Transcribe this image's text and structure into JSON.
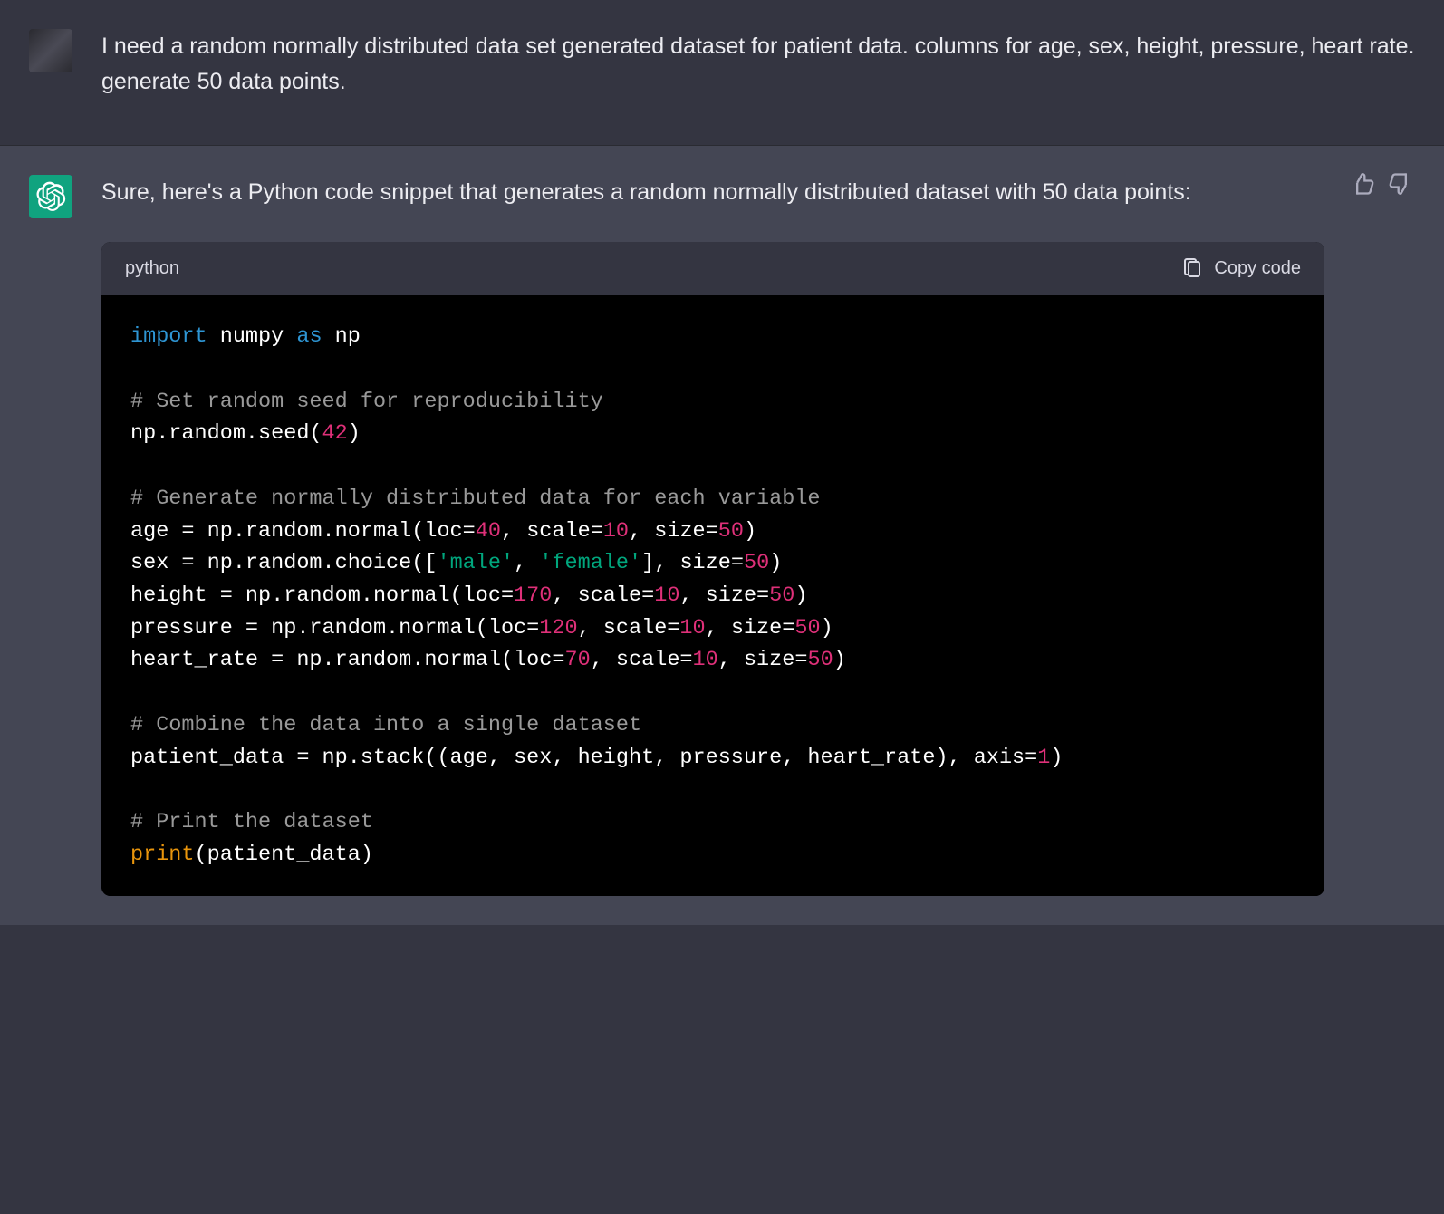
{
  "user": {
    "message": "I need a random normally distributed data set generated dataset for patient data. columns for age, sex, height, pressure, heart rate. generate 50 data points."
  },
  "assistant": {
    "intro": "Sure, here's a Python code snippet that generates a random normally distributed dataset with 50 data points:",
    "code_lang": "python",
    "copy_label": "Copy code",
    "code_tokens": [
      [
        {
          "t": "import ",
          "c": "kw"
        },
        {
          "t": "numpy ",
          "c": "plain"
        },
        {
          "t": "as ",
          "c": "kw"
        },
        {
          "t": "np",
          "c": "plain"
        }
      ],
      [],
      [
        {
          "t": "# Set random seed for reproducibility",
          "c": "com"
        }
      ],
      [
        {
          "t": "np.random.seed(",
          "c": "plain"
        },
        {
          "t": "42",
          "c": "num"
        },
        {
          "t": ")",
          "c": "plain"
        }
      ],
      [],
      [
        {
          "t": "# Generate normally distributed data for each variable",
          "c": "com"
        }
      ],
      [
        {
          "t": "age = np.random.normal(loc=",
          "c": "plain"
        },
        {
          "t": "40",
          "c": "num"
        },
        {
          "t": ", scale=",
          "c": "plain"
        },
        {
          "t": "10",
          "c": "num"
        },
        {
          "t": ", size=",
          "c": "plain"
        },
        {
          "t": "50",
          "c": "num"
        },
        {
          "t": ")",
          "c": "plain"
        }
      ],
      [
        {
          "t": "sex = np.random.choice([",
          "c": "plain"
        },
        {
          "t": "'male'",
          "c": "str"
        },
        {
          "t": ", ",
          "c": "plain"
        },
        {
          "t": "'female'",
          "c": "str"
        },
        {
          "t": "], size=",
          "c": "plain"
        },
        {
          "t": "50",
          "c": "num"
        },
        {
          "t": ")",
          "c": "plain"
        }
      ],
      [
        {
          "t": "height = np.random.normal(loc=",
          "c": "plain"
        },
        {
          "t": "170",
          "c": "num"
        },
        {
          "t": ", scale=",
          "c": "plain"
        },
        {
          "t": "10",
          "c": "num"
        },
        {
          "t": ", size=",
          "c": "plain"
        },
        {
          "t": "50",
          "c": "num"
        },
        {
          "t": ")",
          "c": "plain"
        }
      ],
      [
        {
          "t": "pressure = np.random.normal(loc=",
          "c": "plain"
        },
        {
          "t": "120",
          "c": "num"
        },
        {
          "t": ", scale=",
          "c": "plain"
        },
        {
          "t": "10",
          "c": "num"
        },
        {
          "t": ", size=",
          "c": "plain"
        },
        {
          "t": "50",
          "c": "num"
        },
        {
          "t": ")",
          "c": "plain"
        }
      ],
      [
        {
          "t": "heart_rate = np.random.normal(loc=",
          "c": "plain"
        },
        {
          "t": "70",
          "c": "num"
        },
        {
          "t": ", scale=",
          "c": "plain"
        },
        {
          "t": "10",
          "c": "num"
        },
        {
          "t": ", size=",
          "c": "plain"
        },
        {
          "t": "50",
          "c": "num"
        },
        {
          "t": ")",
          "c": "plain"
        }
      ],
      [],
      [
        {
          "t": "# Combine the data into a single dataset",
          "c": "com"
        }
      ],
      [
        {
          "t": "patient_data = np.stack((age, sex, height, pressure, heart_rate), axis=",
          "c": "plain"
        },
        {
          "t": "1",
          "c": "num"
        },
        {
          "t": ")",
          "c": "plain"
        }
      ],
      [],
      [
        {
          "t": "# Print the dataset",
          "c": "com"
        }
      ],
      [
        {
          "t": "print",
          "c": "fn"
        },
        {
          "t": "(patient_data)",
          "c": "plain"
        }
      ]
    ]
  }
}
